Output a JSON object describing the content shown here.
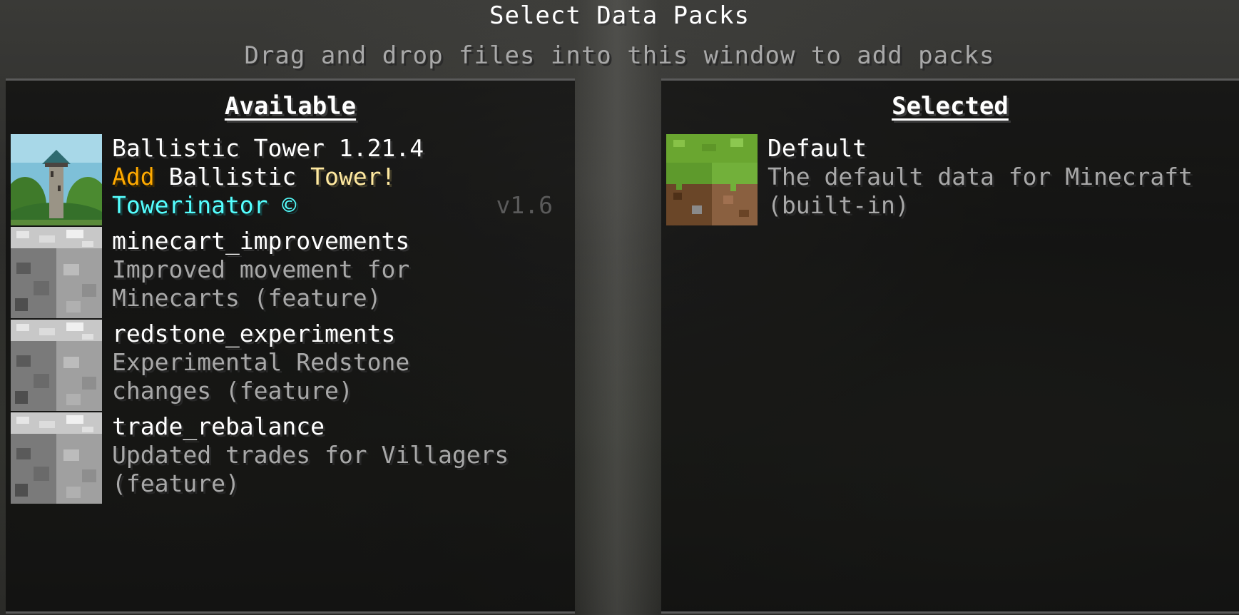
{
  "screen": {
    "title": "Select Data Packs",
    "subtitle": "Drag and drop files into this window to add packs"
  },
  "available": {
    "header": "Available",
    "packs": [
      {
        "icon": "ballistic-tower-icon",
        "name": "Ballistic Tower 1.21.4",
        "desc_parts": [
          "Add",
          " Ballistic",
          " Tower!"
        ],
        "author": "Towerinator ©",
        "version": "v1.6"
      },
      {
        "icon": "cobblestone-icon",
        "name": "minecart_improvements",
        "desc_line1": "Improved movement for",
        "desc_line2": "Minecarts (feature)"
      },
      {
        "icon": "cobblestone-icon",
        "name": "redstone_experiments",
        "desc_line1": "Experimental Redstone",
        "desc_line2": "changes (feature)"
      },
      {
        "icon": "cobblestone-icon",
        "name": "trade_rebalance",
        "desc_line1": "Updated trades for Villagers",
        "desc_line2": "(feature)"
      }
    ]
  },
  "selected": {
    "header": "Selected",
    "packs": [
      {
        "icon": "grass-block-icon",
        "name": "Default",
        "desc_line1": "The default data for Minecraft",
        "desc_line2": "(built-in)"
      }
    ]
  },
  "colors": {
    "orange": "#ffaa00",
    "aqua": "#55ffff",
    "yellow": "#ffe9a0",
    "desc_gray": "#a8a8a8"
  }
}
